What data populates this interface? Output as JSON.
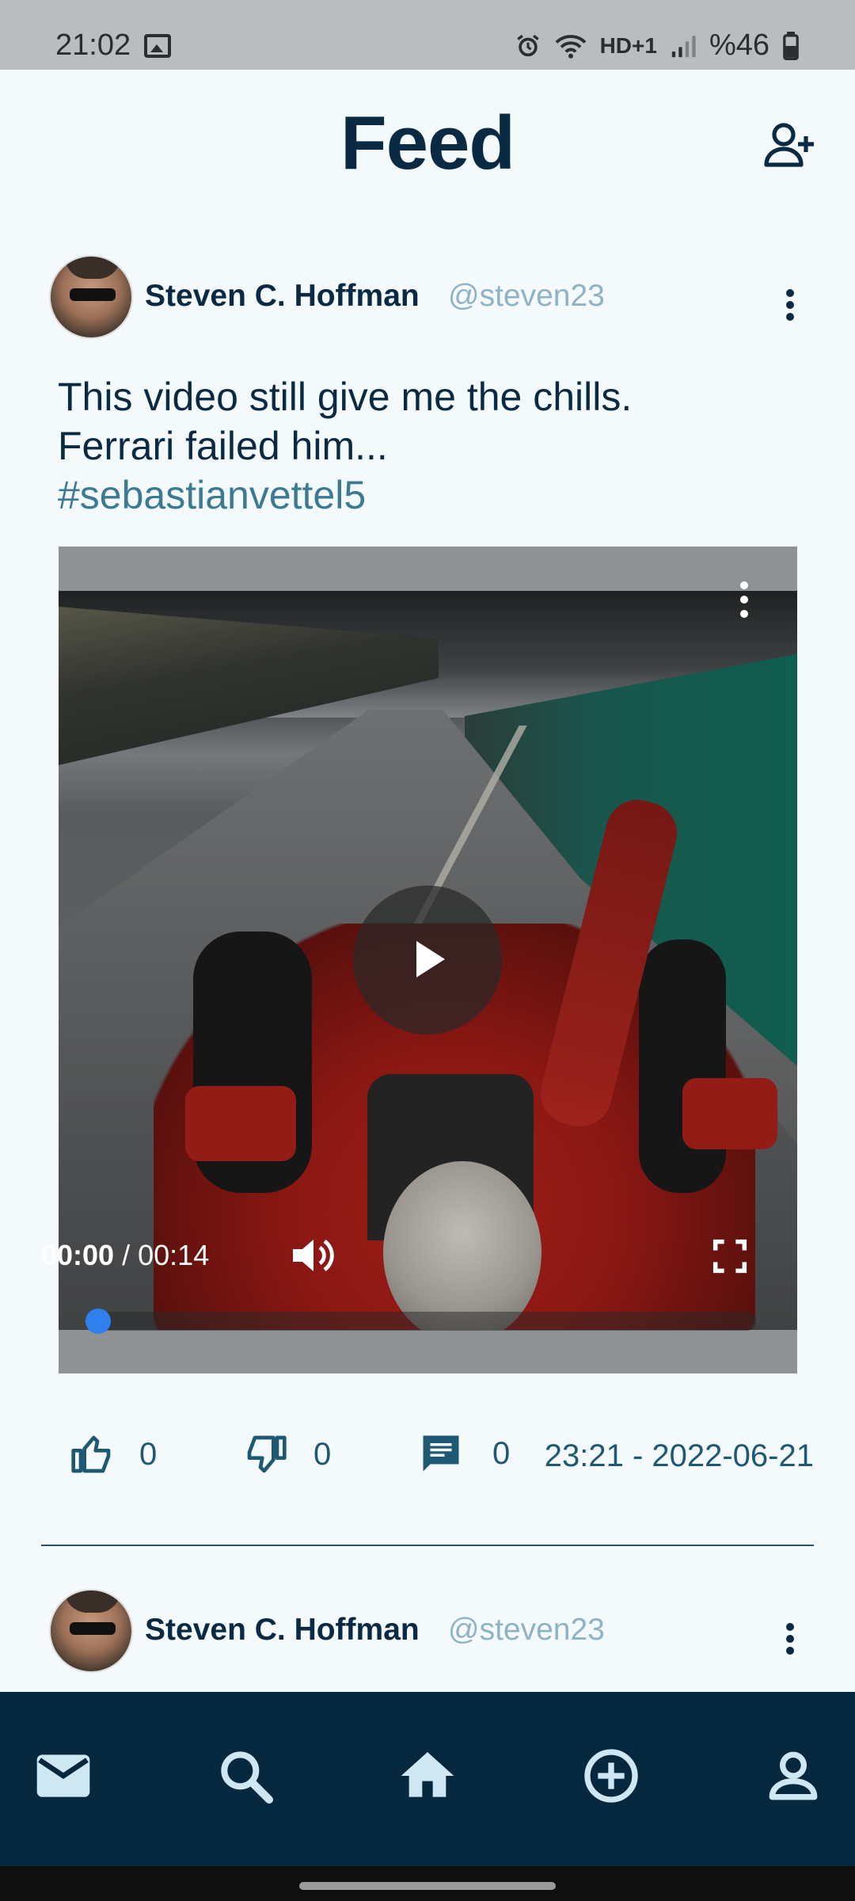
{
  "status_bar": {
    "time": "21:02",
    "battery": "%46",
    "network_label": "HD+1"
  },
  "header": {
    "title": "Feed",
    "add_user_icon": "person-add-icon"
  },
  "posts": [
    {
      "author_name": "Steven C. Hoffman",
      "author_handle": "@steven23",
      "text_line1": "This video still give me the chills.",
      "text_line2": "Ferrari failed him...",
      "hashtag": "#sebastianvettel5",
      "video": {
        "current_time": "00:00",
        "separator": "/",
        "duration": "00:14",
        "progress": 0
      },
      "likes": "0",
      "dislikes": "0",
      "comments": "0",
      "timestamp": "23:21 - 2022-06-21"
    },
    {
      "author_name": "Steven C. Hoffman",
      "author_handle": "@steven23"
    }
  ],
  "bottom_nav": {
    "items": [
      "mail-icon",
      "search-icon",
      "home-icon",
      "add-circle-icon",
      "profile-icon"
    ]
  },
  "colors": {
    "primary": "#0a2a44",
    "accent": "#3c7a93",
    "handle": "#8fb3c4",
    "nav_background": "#06283f",
    "progress": "#2f80ed"
  }
}
